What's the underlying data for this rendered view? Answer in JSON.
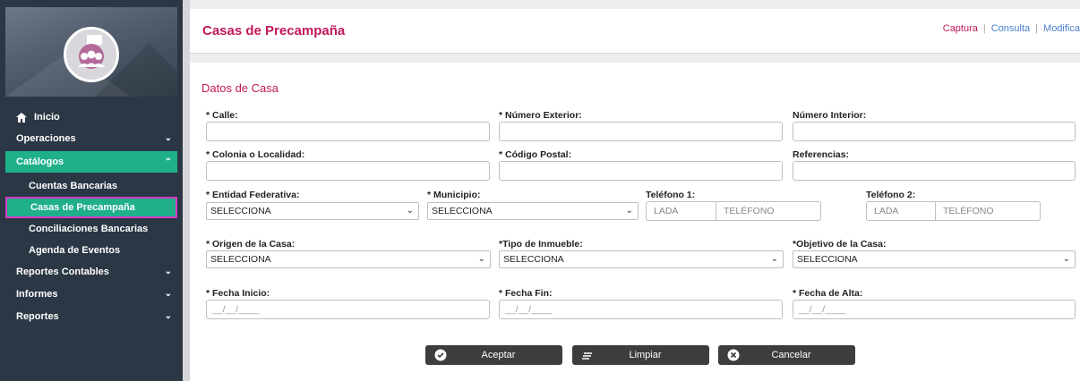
{
  "sidebar": {
    "items": [
      {
        "label": "Inicio"
      },
      {
        "label": "Operaciones"
      },
      {
        "label": "Catálogos"
      },
      {
        "label": "Cuentas Bancarias"
      },
      {
        "label": "Casas de Precampaña"
      },
      {
        "label": "Conciliaciones Bancarias"
      },
      {
        "label": "Agenda de Eventos"
      },
      {
        "label": "Reportes Contables"
      },
      {
        "label": "Informes"
      },
      {
        "label": "Reportes"
      }
    ]
  },
  "header": {
    "title": "Casas de Precampaña",
    "links": [
      "Captura",
      "Consulta",
      "Modifica"
    ],
    "separator": "|"
  },
  "form": {
    "section_title": "Datos de Casa",
    "calle_label": "* Calle:",
    "num_ext_label": "* Número Exterior:",
    "num_int_label": "Número Interior:",
    "colonia_label": "* Colonia o Localidad:",
    "cp_label": "* Código Postal:",
    "referencias_label": "Referencias:",
    "entidad_label": "* Entidad Federativa:",
    "entidad_value": "SELECCIONA",
    "municipio_label": "* Municipio:",
    "municipio_value": "SELECCIONA",
    "tel1_label": "Teléfono 1:",
    "tel2_label": "Teléfono 2:",
    "lada_placeholder": "LADA",
    "telefono_placeholder": "TELÉFONO",
    "origen_label": "* Origen de la Casa:",
    "origen_value": "SELECCIONA",
    "tipo_label": "*Tipo de Inmueble:",
    "tipo_value": "SELECCIONA",
    "objetivo_label": "*Objetivo de la Casa:",
    "objetivo_value": "SELECCIONA",
    "fecha_inicio_label": "* Fecha Inicio:",
    "fecha_fin_label": "* Fecha Fin:",
    "fecha_alta_label": "* Fecha de Alta:",
    "date_placeholder": "__/__/____"
  },
  "buttons": {
    "aceptar": "Aceptar",
    "limpiar": "Limpiar",
    "cancelar": "Cancelar"
  },
  "colors": {
    "accent_pink": "#c2185b",
    "sidebar_bg": "#2b3745",
    "active_green": "#1fb08a",
    "highlight_border": "#d639c4",
    "link_blue": "#4a7ec9"
  }
}
